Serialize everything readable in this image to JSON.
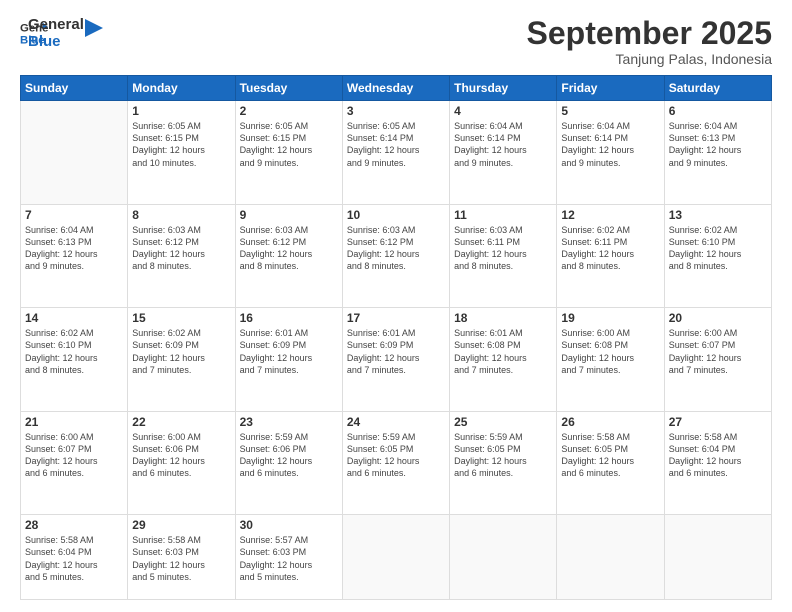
{
  "header": {
    "logo_line1": "General",
    "logo_line2": "Blue",
    "month": "September 2025",
    "location": "Tanjung Palas, Indonesia"
  },
  "weekdays": [
    "Sunday",
    "Monday",
    "Tuesday",
    "Wednesday",
    "Thursday",
    "Friday",
    "Saturday"
  ],
  "weeks": [
    [
      {
        "day": "",
        "info": ""
      },
      {
        "day": "1",
        "info": "Sunrise: 6:05 AM\nSunset: 6:15 PM\nDaylight: 12 hours\nand 10 minutes."
      },
      {
        "day": "2",
        "info": "Sunrise: 6:05 AM\nSunset: 6:15 PM\nDaylight: 12 hours\nand 9 minutes."
      },
      {
        "day": "3",
        "info": "Sunrise: 6:05 AM\nSunset: 6:14 PM\nDaylight: 12 hours\nand 9 minutes."
      },
      {
        "day": "4",
        "info": "Sunrise: 6:04 AM\nSunset: 6:14 PM\nDaylight: 12 hours\nand 9 minutes."
      },
      {
        "day": "5",
        "info": "Sunrise: 6:04 AM\nSunset: 6:14 PM\nDaylight: 12 hours\nand 9 minutes."
      },
      {
        "day": "6",
        "info": "Sunrise: 6:04 AM\nSunset: 6:13 PM\nDaylight: 12 hours\nand 9 minutes."
      }
    ],
    [
      {
        "day": "7",
        "info": "Sunrise: 6:04 AM\nSunset: 6:13 PM\nDaylight: 12 hours\nand 9 minutes."
      },
      {
        "day": "8",
        "info": "Sunrise: 6:03 AM\nSunset: 6:12 PM\nDaylight: 12 hours\nand 8 minutes."
      },
      {
        "day": "9",
        "info": "Sunrise: 6:03 AM\nSunset: 6:12 PM\nDaylight: 12 hours\nand 8 minutes."
      },
      {
        "day": "10",
        "info": "Sunrise: 6:03 AM\nSunset: 6:12 PM\nDaylight: 12 hours\nand 8 minutes."
      },
      {
        "day": "11",
        "info": "Sunrise: 6:03 AM\nSunset: 6:11 PM\nDaylight: 12 hours\nand 8 minutes."
      },
      {
        "day": "12",
        "info": "Sunrise: 6:02 AM\nSunset: 6:11 PM\nDaylight: 12 hours\nand 8 minutes."
      },
      {
        "day": "13",
        "info": "Sunrise: 6:02 AM\nSunset: 6:10 PM\nDaylight: 12 hours\nand 8 minutes."
      }
    ],
    [
      {
        "day": "14",
        "info": "Sunrise: 6:02 AM\nSunset: 6:10 PM\nDaylight: 12 hours\nand 8 minutes."
      },
      {
        "day": "15",
        "info": "Sunrise: 6:02 AM\nSunset: 6:09 PM\nDaylight: 12 hours\nand 7 minutes."
      },
      {
        "day": "16",
        "info": "Sunrise: 6:01 AM\nSunset: 6:09 PM\nDaylight: 12 hours\nand 7 minutes."
      },
      {
        "day": "17",
        "info": "Sunrise: 6:01 AM\nSunset: 6:09 PM\nDaylight: 12 hours\nand 7 minutes."
      },
      {
        "day": "18",
        "info": "Sunrise: 6:01 AM\nSunset: 6:08 PM\nDaylight: 12 hours\nand 7 minutes."
      },
      {
        "day": "19",
        "info": "Sunrise: 6:00 AM\nSunset: 6:08 PM\nDaylight: 12 hours\nand 7 minutes."
      },
      {
        "day": "20",
        "info": "Sunrise: 6:00 AM\nSunset: 6:07 PM\nDaylight: 12 hours\nand 7 minutes."
      }
    ],
    [
      {
        "day": "21",
        "info": "Sunrise: 6:00 AM\nSunset: 6:07 PM\nDaylight: 12 hours\nand 6 minutes."
      },
      {
        "day": "22",
        "info": "Sunrise: 6:00 AM\nSunset: 6:06 PM\nDaylight: 12 hours\nand 6 minutes."
      },
      {
        "day": "23",
        "info": "Sunrise: 5:59 AM\nSunset: 6:06 PM\nDaylight: 12 hours\nand 6 minutes."
      },
      {
        "day": "24",
        "info": "Sunrise: 5:59 AM\nSunset: 6:05 PM\nDaylight: 12 hours\nand 6 minutes."
      },
      {
        "day": "25",
        "info": "Sunrise: 5:59 AM\nSunset: 6:05 PM\nDaylight: 12 hours\nand 6 minutes."
      },
      {
        "day": "26",
        "info": "Sunrise: 5:58 AM\nSunset: 6:05 PM\nDaylight: 12 hours\nand 6 minutes."
      },
      {
        "day": "27",
        "info": "Sunrise: 5:58 AM\nSunset: 6:04 PM\nDaylight: 12 hours\nand 6 minutes."
      }
    ],
    [
      {
        "day": "28",
        "info": "Sunrise: 5:58 AM\nSunset: 6:04 PM\nDaylight: 12 hours\nand 5 minutes."
      },
      {
        "day": "29",
        "info": "Sunrise: 5:58 AM\nSunset: 6:03 PM\nDaylight: 12 hours\nand 5 minutes."
      },
      {
        "day": "30",
        "info": "Sunrise: 5:57 AM\nSunset: 6:03 PM\nDaylight: 12 hours\nand 5 minutes."
      },
      {
        "day": "",
        "info": ""
      },
      {
        "day": "",
        "info": ""
      },
      {
        "day": "",
        "info": ""
      },
      {
        "day": "",
        "info": ""
      }
    ]
  ]
}
